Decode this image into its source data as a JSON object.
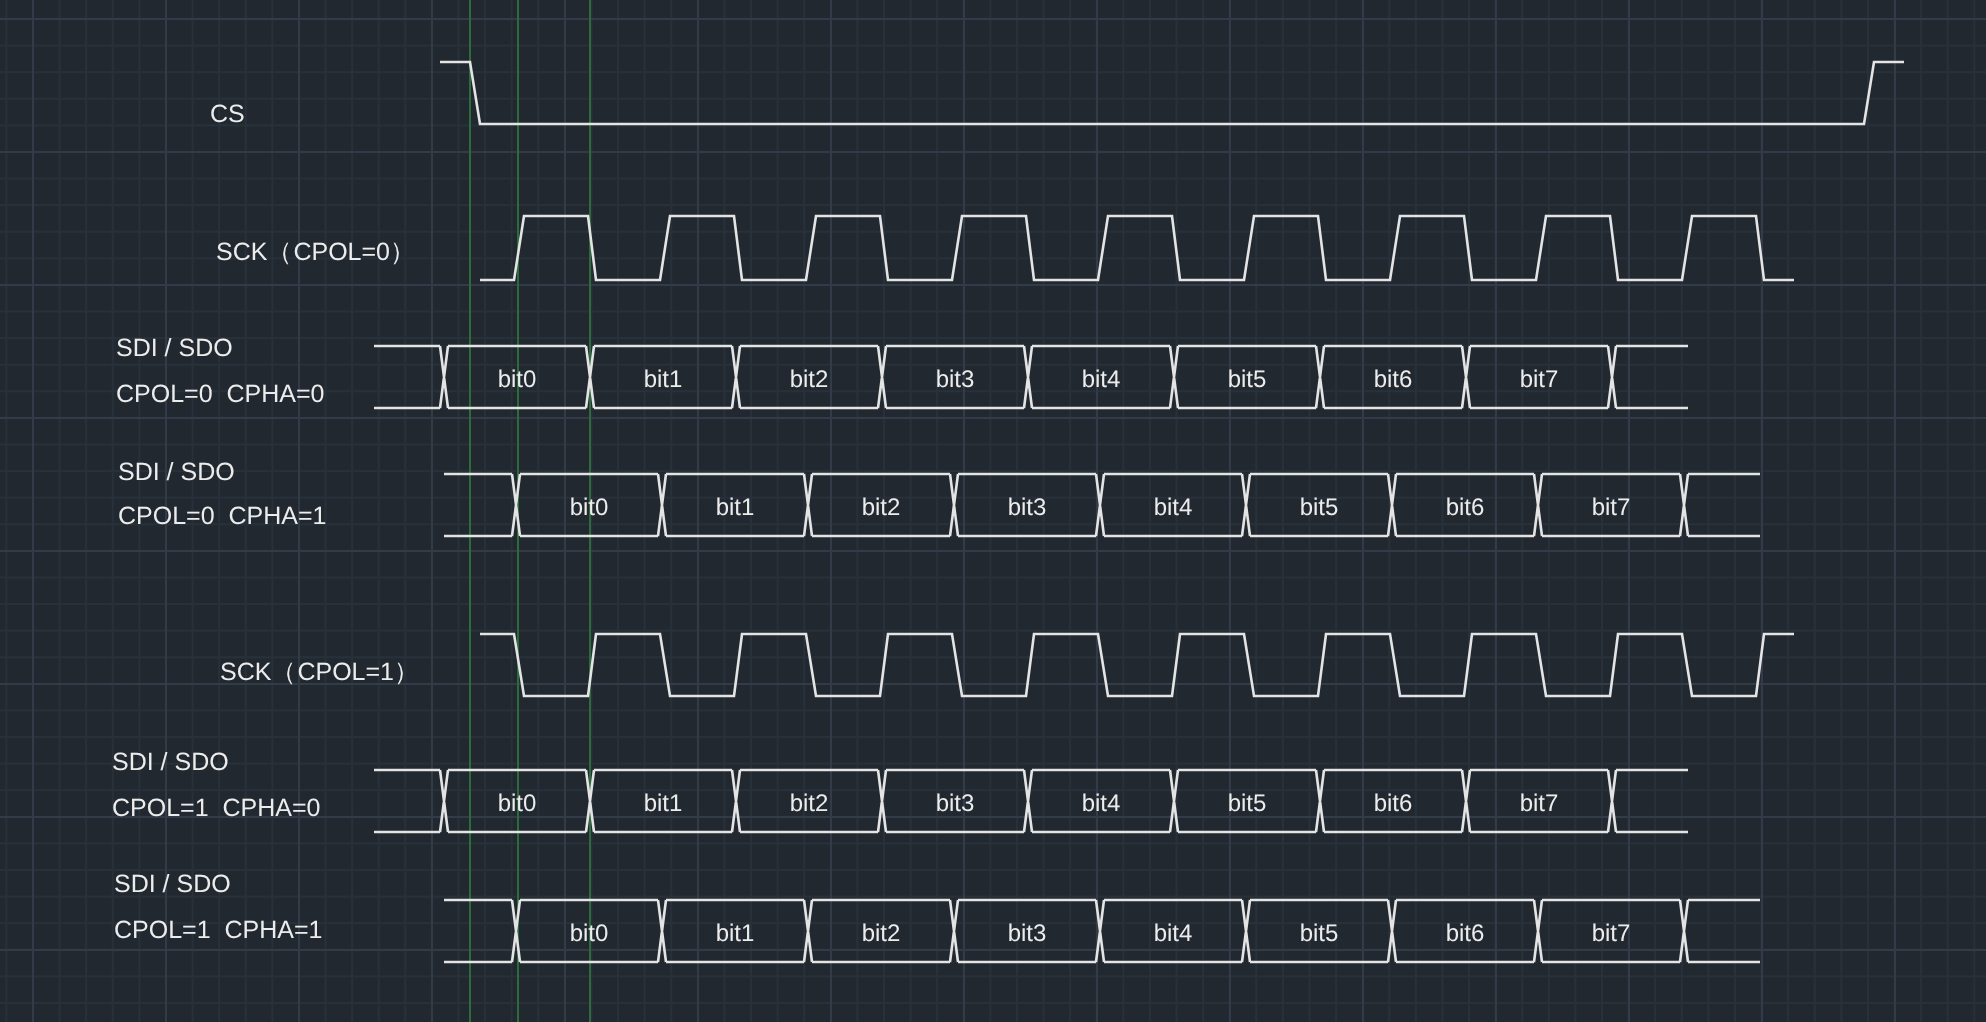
{
  "signals": [
    {
      "kind": "select",
      "labels": [
        "CS"
      ]
    },
    {
      "kind": "clock",
      "labels": [
        "SCK（CPOL=0）"
      ],
      "idle_high": false
    },
    {
      "kind": "data",
      "labels": [
        "SDI / SDO",
        "CPOL=0  CPHA=0"
      ],
      "shifted": false,
      "bits": [
        "bit0",
        "bit1",
        "bit2",
        "bit3",
        "bit4",
        "bit5",
        "bit6",
        "bit7"
      ]
    },
    {
      "kind": "data",
      "labels": [
        "SDI / SDO",
        "CPOL=0  CPHA=1"
      ],
      "shifted": true,
      "bits": [
        "bit0",
        "bit1",
        "bit2",
        "bit3",
        "bit4",
        "bit5",
        "bit6",
        "bit7"
      ]
    },
    {
      "kind": "clock",
      "labels": [
        "SCK（CPOL=1）"
      ],
      "idle_high": true
    },
    {
      "kind": "data",
      "labels": [
        "SDI / SDO",
        "CPOL=1  CPHA=0"
      ],
      "shifted": false,
      "bits": [
        "bit0",
        "bit1",
        "bit2",
        "bit3",
        "bit4",
        "bit5",
        "bit6",
        "bit7"
      ]
    },
    {
      "kind": "data",
      "labels": [
        "SDI / SDO",
        "CPOL=1  CPHA=1"
      ],
      "shifted": true,
      "bits": [
        "bit0",
        "bit1",
        "bit2",
        "bit3",
        "bit4",
        "bit5",
        "bit6",
        "bit7"
      ]
    }
  ]
}
